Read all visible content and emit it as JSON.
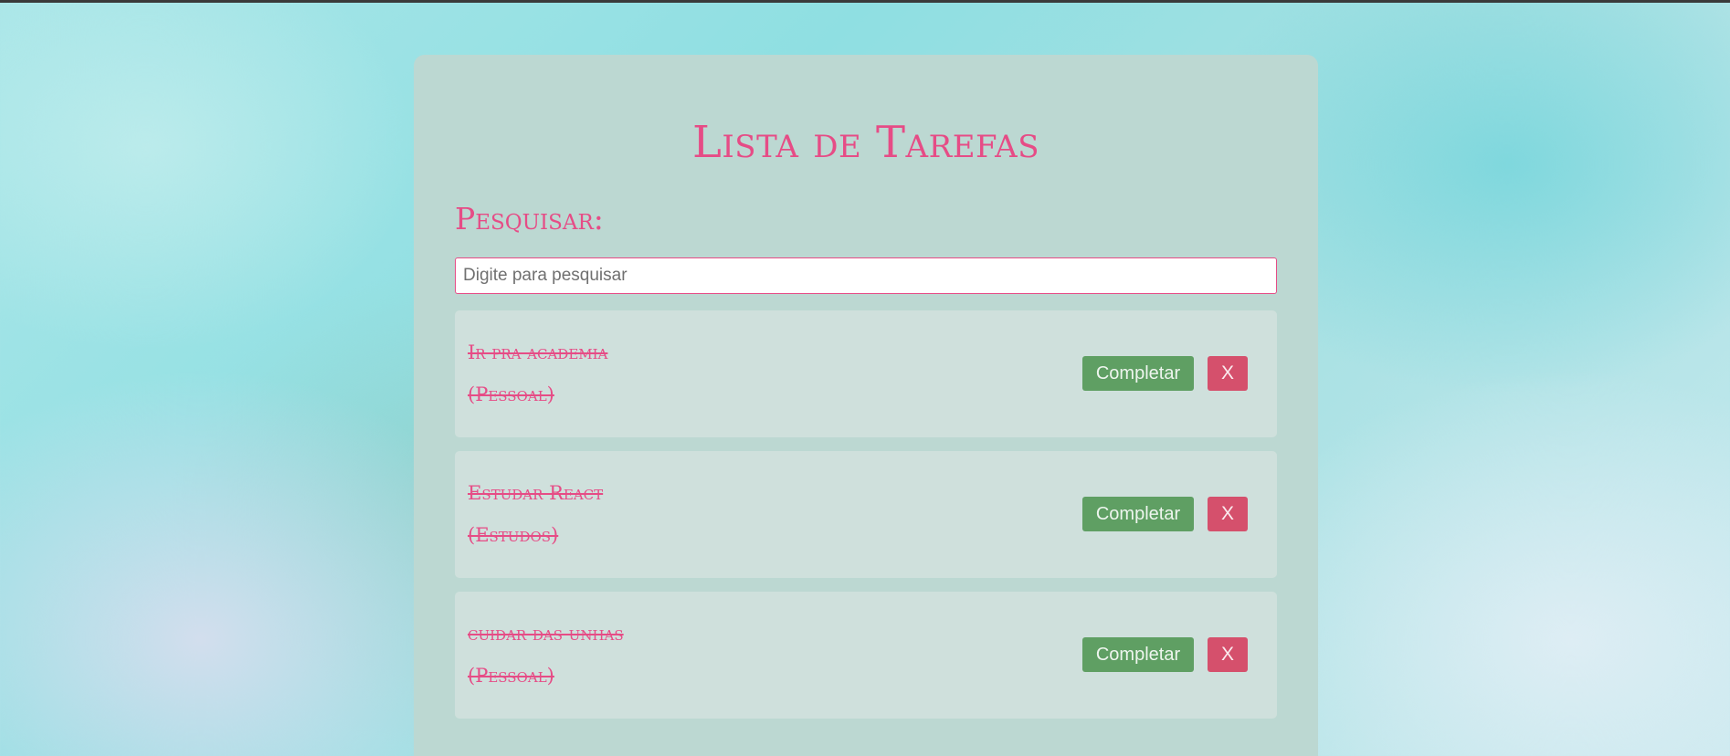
{
  "app": {
    "title": "Lista de Tarefas"
  },
  "search": {
    "label": "Pesquisar:",
    "placeholder": "Digite para pesquisar",
    "value": ""
  },
  "tasks": [
    {
      "text": "Ir pra academia",
      "category": "(Pessoal)",
      "completed": true,
      "complete_label": "Completar",
      "remove_label": "X"
    },
    {
      "text": "Estudar React",
      "category": "(Estudos)",
      "completed": true,
      "complete_label": "Completar",
      "remove_label": "X"
    },
    {
      "text": "cuidar das unhas",
      "category": "(Pessoal)",
      "completed": true,
      "complete_label": "Completar",
      "remove_label": "X"
    }
  ],
  "colors": {
    "accent": "#e64c86",
    "complete_button": "#5f9f63",
    "remove_button": "#d5506c",
    "panel": "#bcd8d2",
    "task_card": "#cfe0dc"
  }
}
